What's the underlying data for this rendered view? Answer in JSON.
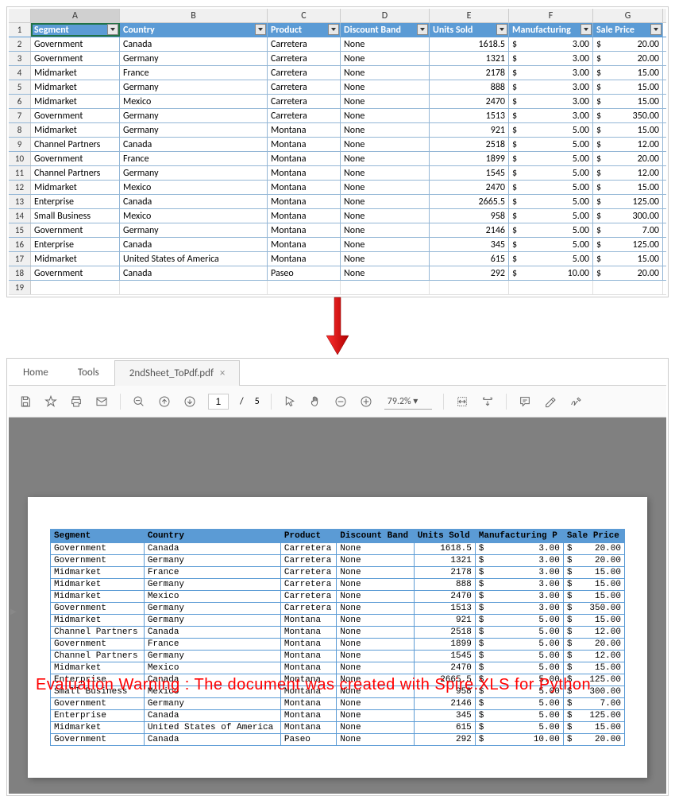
{
  "spreadsheet": {
    "columns": [
      "A",
      "B",
      "C",
      "D",
      "E",
      "F",
      "G"
    ],
    "headers": [
      "Segment",
      "Country",
      "Product",
      "Discount Band",
      "Units Sold",
      "Manufacturing",
      "Sale Price"
    ],
    "rows": [
      {
        "n": 2,
        "segment": "Government",
        "country": "Canada",
        "product": "Carretera",
        "discount": "None",
        "units": "1618.5",
        "mfg": "3.00",
        "price": "20.00"
      },
      {
        "n": 3,
        "segment": "Government",
        "country": "Germany",
        "product": "Carretera",
        "discount": "None",
        "units": "1321",
        "mfg": "3.00",
        "price": "20.00"
      },
      {
        "n": 4,
        "segment": "Midmarket",
        "country": "France",
        "product": "Carretera",
        "discount": "None",
        "units": "2178",
        "mfg": "3.00",
        "price": "15.00"
      },
      {
        "n": 5,
        "segment": "Midmarket",
        "country": "Germany",
        "product": "Carretera",
        "discount": "None",
        "units": "888",
        "mfg": "3.00",
        "price": "15.00"
      },
      {
        "n": 6,
        "segment": "Midmarket",
        "country": "Mexico",
        "product": "Carretera",
        "discount": "None",
        "units": "2470",
        "mfg": "3.00",
        "price": "15.00"
      },
      {
        "n": 7,
        "segment": "Government",
        "country": "Germany",
        "product": "Carretera",
        "discount": "None",
        "units": "1513",
        "mfg": "3.00",
        "price": "350.00"
      },
      {
        "n": 8,
        "segment": "Midmarket",
        "country": "Germany",
        "product": "Montana",
        "discount": "None",
        "units": "921",
        "mfg": "5.00",
        "price": "15.00"
      },
      {
        "n": 9,
        "segment": "Channel Partners",
        "country": "Canada",
        "product": "Montana",
        "discount": "None",
        "units": "2518",
        "mfg": "5.00",
        "price": "12.00"
      },
      {
        "n": 10,
        "segment": "Government",
        "country": "France",
        "product": "Montana",
        "discount": "None",
        "units": "1899",
        "mfg": "5.00",
        "price": "20.00"
      },
      {
        "n": 11,
        "segment": "Channel Partners",
        "country": "Germany",
        "product": "Montana",
        "discount": "None",
        "units": "1545",
        "mfg": "5.00",
        "price": "12.00"
      },
      {
        "n": 12,
        "segment": "Midmarket",
        "country": "Mexico",
        "product": "Montana",
        "discount": "None",
        "units": "2470",
        "mfg": "5.00",
        "price": "15.00"
      },
      {
        "n": 13,
        "segment": "Enterprise",
        "country": "Canada",
        "product": "Montana",
        "discount": "None",
        "units": "2665.5",
        "mfg": "5.00",
        "price": "125.00"
      },
      {
        "n": 14,
        "segment": "Small Business",
        "country": "Mexico",
        "product": "Montana",
        "discount": "None",
        "units": "958",
        "mfg": "5.00",
        "price": "300.00"
      },
      {
        "n": 15,
        "segment": "Government",
        "country": "Germany",
        "product": "Montana",
        "discount": "None",
        "units": "2146",
        "mfg": "5.00",
        "price": "7.00"
      },
      {
        "n": 16,
        "segment": "Enterprise",
        "country": "Canada",
        "product": "Montana",
        "discount": "None",
        "units": "345",
        "mfg": "5.00",
        "price": "125.00"
      },
      {
        "n": 17,
        "segment": "Midmarket",
        "country": "United States of America",
        "product": "Montana",
        "discount": "None",
        "units": "615",
        "mfg": "5.00",
        "price": "15.00"
      },
      {
        "n": 18,
        "segment": "Government",
        "country": "Canada",
        "product": "Paseo",
        "discount": "None",
        "units": "292",
        "mfg": "10.00",
        "price": "20.00"
      }
    ],
    "empty_row": 19,
    "currency_symbol": "$"
  },
  "pdf": {
    "tabs": {
      "home": "Home",
      "tools": "Tools",
      "file": "2ndSheet_ToPdf.pdf"
    },
    "page_current": "1",
    "page_sep": "/",
    "page_total": "5",
    "zoom": "79.2%",
    "headers": [
      "Segment",
      "Country",
      "Product",
      "Discount Band",
      "Units Sold",
      "Manufacturing P",
      "Sale Price"
    ],
    "warning": "Evaluation Warning : The document was created with  Spire.XLS for Python"
  }
}
